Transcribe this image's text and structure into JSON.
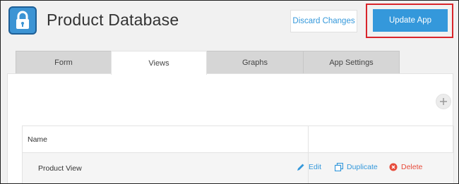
{
  "header": {
    "app_title": "Product Database",
    "app_icon": "lock-icon",
    "discard_label": "Discard Changes",
    "update_label": "Update App"
  },
  "tabs": [
    {
      "label": "Form",
      "active": false
    },
    {
      "label": "Views",
      "active": true
    },
    {
      "label": "Graphs",
      "active": false
    },
    {
      "label": "App Settings",
      "active": false
    }
  ],
  "views_table": {
    "header_name": "Name",
    "rows": [
      {
        "name": "Product View",
        "edit_label": "Edit",
        "duplicate_label": "Duplicate",
        "delete_label": "Delete"
      }
    ]
  },
  "colors": {
    "accent": "#3498db",
    "delete": "#e74c3c",
    "highlight": "#d9252b"
  }
}
